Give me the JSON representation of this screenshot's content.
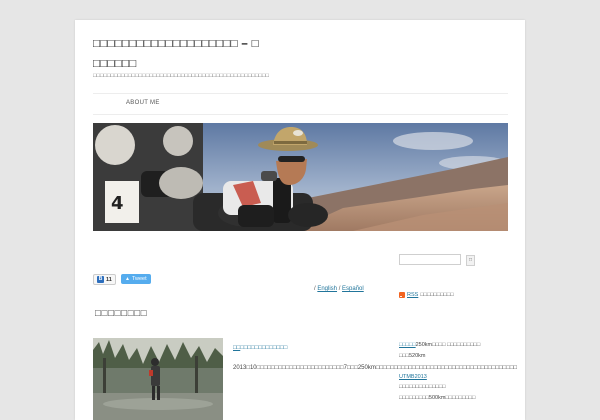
{
  "site": {
    "title": "□□□□□□□□□□□□□□□□□□□□ – □ □□□□□□",
    "description": "□□□□□□□□□□□□□□□□□□□□□□□□□□□□□□□□□□□□□□□□□□□□□□□□□□"
  },
  "nav": {
    "items": [
      {
        "label": "ABOUT ME"
      }
    ]
  },
  "share": {
    "hatena_count": "11",
    "tweet_label": "Tweet"
  },
  "languages": {
    "sep": "/",
    "english": "English",
    "spanish": "Español"
  },
  "section": {
    "title": "□□□□□□□□"
  },
  "post": {
    "title_prefix": "□□",
    "title_rest": "□□□□□□□□□□□□□",
    "excerpt": "2013□10□□□□□□□□□□□□□□□□□□□□□□□□7□□□250km□□□□□□□□□□□□□□□□□□□□□□□□□□□□□□□□□□□□□□□"
  },
  "sidebar": {
    "search_placeholder": "",
    "search_button": "□",
    "rss_prefix": "RSS",
    "rss_rest": "□□□□□□□□□□",
    "recent": [
      {
        "prefix": "□□□□□",
        "rest": "250km□□□□ □□□□□□□□□□"
      },
      {
        "prefix": "",
        "rest": "□□□520km"
      },
      {
        "prefix": "UTMB2013",
        "rest": ""
      },
      {
        "prefix": "",
        "rest": "□□□□□□□□□□□□□□"
      },
      {
        "prefix": "",
        "rest": "□□□□□□□□□500km□□□□□□□□□"
      }
    ]
  },
  "colors": {
    "link": "#21759b",
    "tweet": "#55acee",
    "rss": "#f26522",
    "hatena": "#2c6ebd"
  }
}
